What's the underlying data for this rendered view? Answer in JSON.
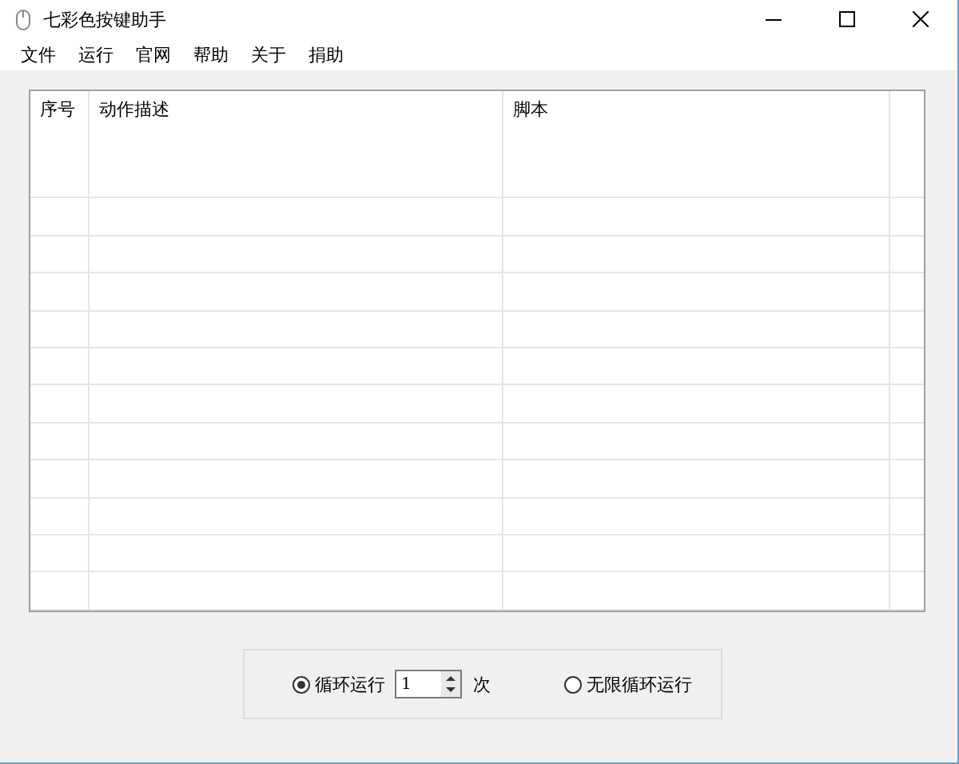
{
  "window": {
    "title": "七彩色按键助手"
  },
  "menu": [
    "文件",
    "运行",
    "官网",
    "帮助",
    "关于",
    "捐助"
  ],
  "table": {
    "columns": [
      "序号",
      "动作描述",
      "脚本"
    ]
  },
  "loop_options": [
    {
      "kind": "count",
      "label": "循环运行",
      "selected": true,
      "value": "1",
      "unit": "次"
    },
    {
      "kind": "infinite",
      "label": "无限循环运行",
      "selected": false
    }
  ]
}
